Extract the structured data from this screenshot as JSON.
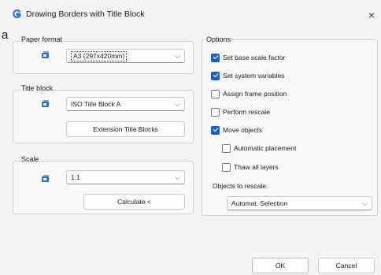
{
  "window": {
    "title": "Drawing Borders with Title Block",
    "close_glyph": "×"
  },
  "stray": "a",
  "paper": {
    "label": "Paper format",
    "value": "A3 (297x420mm)"
  },
  "title_block": {
    "label": "Title block",
    "value": "ISO Title Block A",
    "ext_button": "Extension Title Blocks"
  },
  "scale": {
    "label": "Scale",
    "value": "1:1",
    "calc_button": "Calculate <"
  },
  "options": {
    "label": "Options",
    "items": [
      {
        "label": "Set base scale factor",
        "checked": true
      },
      {
        "label": "Set system variables",
        "checked": true
      },
      {
        "label": "Assign frame position",
        "checked": false
      },
      {
        "label": "Perform rescale",
        "checked": false
      },
      {
        "label": "Move objects",
        "checked": true
      },
      {
        "label": "Automatic placement",
        "checked": false
      },
      {
        "label": "Thaw all layers",
        "checked": false
      }
    ],
    "rescale_label": "Objects to rescale:",
    "rescale_value": "Automat. Selection"
  },
  "buttons": {
    "ok": "OK",
    "cancel": "Cancel"
  },
  "colors": {
    "accent": "#1d5fc7",
    "icon_blue": "#2a6fd6"
  }
}
